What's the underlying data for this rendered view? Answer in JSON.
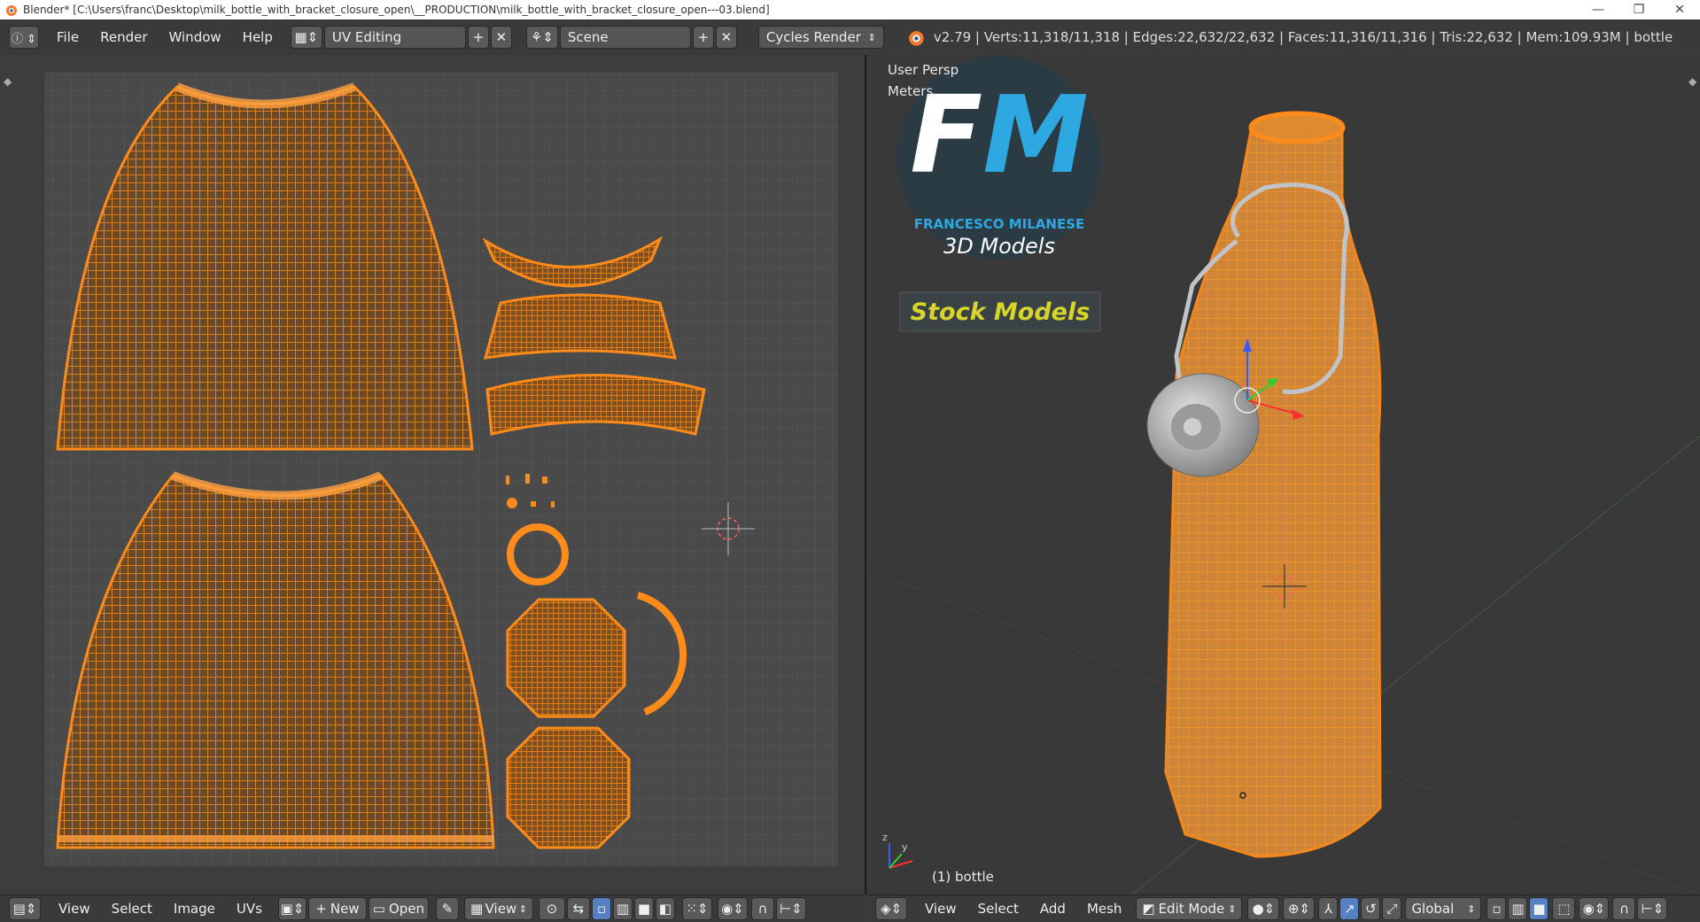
{
  "window": {
    "title": "Blender* [C:\\Users\\franc\\Desktop\\milk_bottle_with_bracket_closure_open\\__PRODUCTION\\milk_bottle_with_bracket_closure_open---03.blend]",
    "minimize": "—",
    "maximize": "❐",
    "close": "✕"
  },
  "header": {
    "menus": [
      "File",
      "Render",
      "Window",
      "Help"
    ],
    "layout": "UV Editing",
    "scene": "Scene",
    "engine": "Cycles Render",
    "stats": "v2.79 | Verts:11,318/11,318 | Edges:22,632/22,632 | Faces:11,316/11,316 | Tris:22,632 | Mem:109.93M | bottle"
  },
  "viewport": {
    "view_name": "User Persp",
    "units": "Meters",
    "object_label": "(1) bottle",
    "watermark": {
      "letters": "FM",
      "author": "FRANCESCO MILANESE",
      "product": "3D Models",
      "banner": "Stock Models"
    }
  },
  "uv_footer": {
    "menus": [
      "View",
      "Select",
      "Image",
      "UVs"
    ],
    "new_label": "New",
    "open_label": "Open",
    "view_label": "View"
  },
  "view_footer": {
    "menus": [
      "View",
      "Select",
      "Add",
      "Mesh"
    ],
    "mode": "Edit Mode",
    "orientation": "Global"
  },
  "colors": {
    "wire": "#ff8c1a",
    "wire_dark": "#c86a10",
    "uv_bg": "#4a4a4a",
    "grid": "#545454",
    "accent": "#4a8fd6"
  }
}
